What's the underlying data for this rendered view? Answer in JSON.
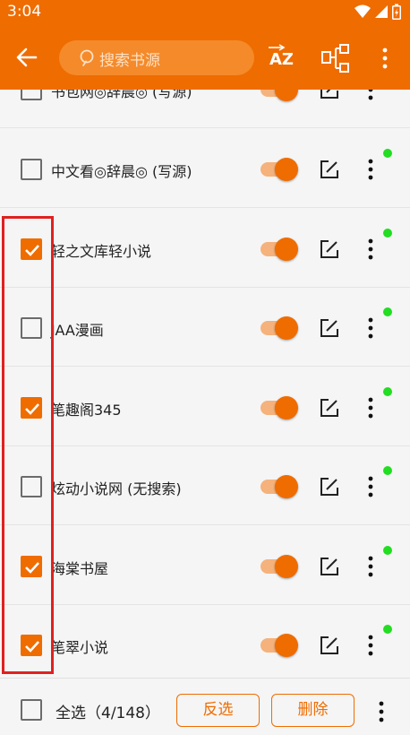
{
  "status": {
    "time": "3:04",
    "icons": [
      "wifi-icon",
      "signal-icon",
      "battery-icon"
    ]
  },
  "appbar": {
    "back_icon": "arrow-back-icon",
    "search_placeholder": "搜索书源",
    "sort_label": "AZ",
    "group_icon": "group-icon",
    "more_icon": "more-vert-icon"
  },
  "sources": [
    {
      "name": "书包网◎辞晨◎ (写源)",
      "checked": false,
      "enabled": true,
      "dot": false
    },
    {
      "name": "中文看◎辞晨◎ (写源)",
      "checked": false,
      "enabled": true,
      "dot": true
    },
    {
      "name": "轻之文库轻小说",
      "checked": true,
      "enabled": true,
      "dot": true
    },
    {
      "name": "JAA漫画",
      "checked": false,
      "enabled": true,
      "dot": true
    },
    {
      "name": "笔趣阁345",
      "checked": true,
      "enabled": true,
      "dot": true
    },
    {
      "name": "炫动小说网 (无搜索)",
      "checked": false,
      "enabled": true,
      "dot": true
    },
    {
      "name": "海棠书屋",
      "checked": true,
      "enabled": true,
      "dot": true
    },
    {
      "name": "笔翠小说",
      "checked": true,
      "enabled": true,
      "dot": true
    }
  ],
  "bottom": {
    "select_all_label": "全选（4/148）",
    "select_all_checked": false,
    "invert_label": "反选",
    "delete_label": "删除"
  },
  "colors": {
    "accent": "#ef6c00",
    "enabled_dot": "#22dd22",
    "highlight": "#e02020"
  }
}
